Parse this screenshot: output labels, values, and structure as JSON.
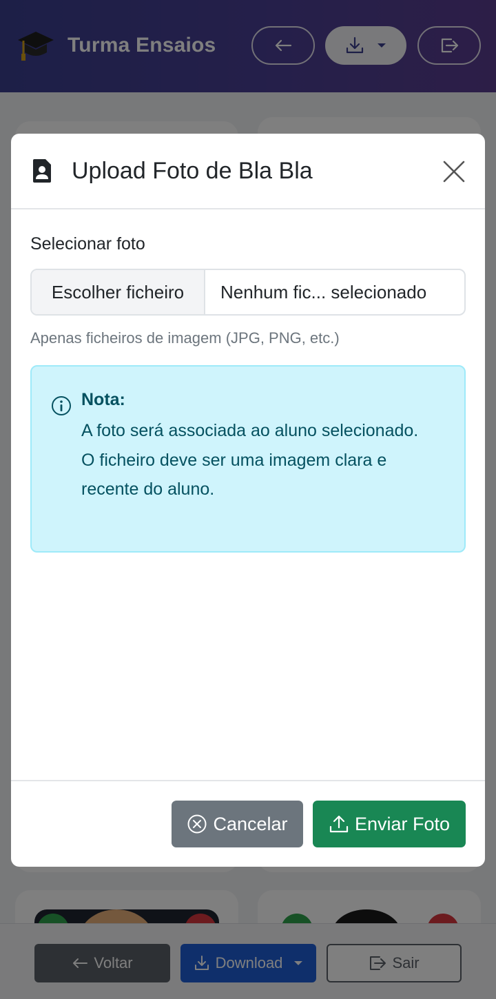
{
  "header": {
    "app_title": "Turma Ensaios",
    "brand_icon": "graduation-cap-icon",
    "back_icon": "arrow-left-icon",
    "download_icon": "download-icon",
    "exit_icon": "logout-icon",
    "gradient": [
      "#3a3f8f",
      "#5a3d8f"
    ]
  },
  "modal": {
    "title": "Upload Foto de Bla Bla",
    "title_icon": "person-badge-icon",
    "close_icon": "close-icon",
    "select_label": "Selecionar foto",
    "file_button": "Escolher ficheiro",
    "file_status": "Nenhum fic... selecionado",
    "help_text": "Apenas ficheiros de imagem (JPG, PNG, etc.)",
    "note": {
      "title": "Nota:",
      "lines": [
        "A foto será associada ao aluno selecionado.",
        "O ficheiro deve ser uma imagem clara e recente do aluno."
      ],
      "icon": "info-icon",
      "background": "#cff4fc",
      "text_color": "#055160"
    },
    "cancel_label": "Cancelar",
    "submit_label": "Enviar Foto",
    "cancel_color": "#6c757d",
    "submit_color": "#198754"
  },
  "footer": {
    "back_label": "Voltar",
    "download_label": "Download",
    "exit_label": "Sair",
    "download_color": "#1f5fd7"
  }
}
